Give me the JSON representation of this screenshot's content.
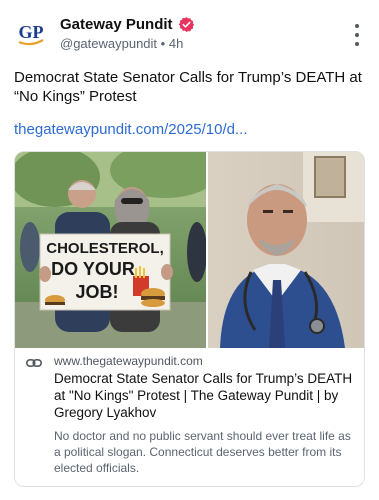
{
  "account": {
    "display_name": "Gateway Pundit",
    "handle": "@gatewaypundit",
    "separator": "•",
    "timestamp": "4h",
    "avatar_logo": "GP",
    "verified": true
  },
  "icons": {
    "verified": "verified-badge-icon",
    "more": "more-vertical-icon",
    "link": "link-chain-icon"
  },
  "post": {
    "text": "Democrat State Senator Calls for Trump’s DEATH at “No Kings” Protest",
    "link_text": "thegatewaypundit.com/2025/10/d..."
  },
  "card": {
    "domain": "www.thegatewaypundit.com",
    "title": "Democrat State Senator Calls for Trump’s DEATH at \"No Kings\" Protest | The Gateway Pundit | by Gregory Lyakhov",
    "description": "No doctor and no public servant should ever treat life as a political slogan. Connecticut deserves better from its elected officials.",
    "image": {
      "sign_line1": "CHOLESTEROL,",
      "sign_line2": "DO YOUR",
      "sign_line3": "JOB!"
    }
  },
  "colors": {
    "link": "#2d6bd6",
    "verified_badge": "#e8355f",
    "logo_blue": "#1a3d8f",
    "logo_orange": "#e8a22a",
    "secondary_text": "#5b6470",
    "border": "#dfe1e4"
  }
}
